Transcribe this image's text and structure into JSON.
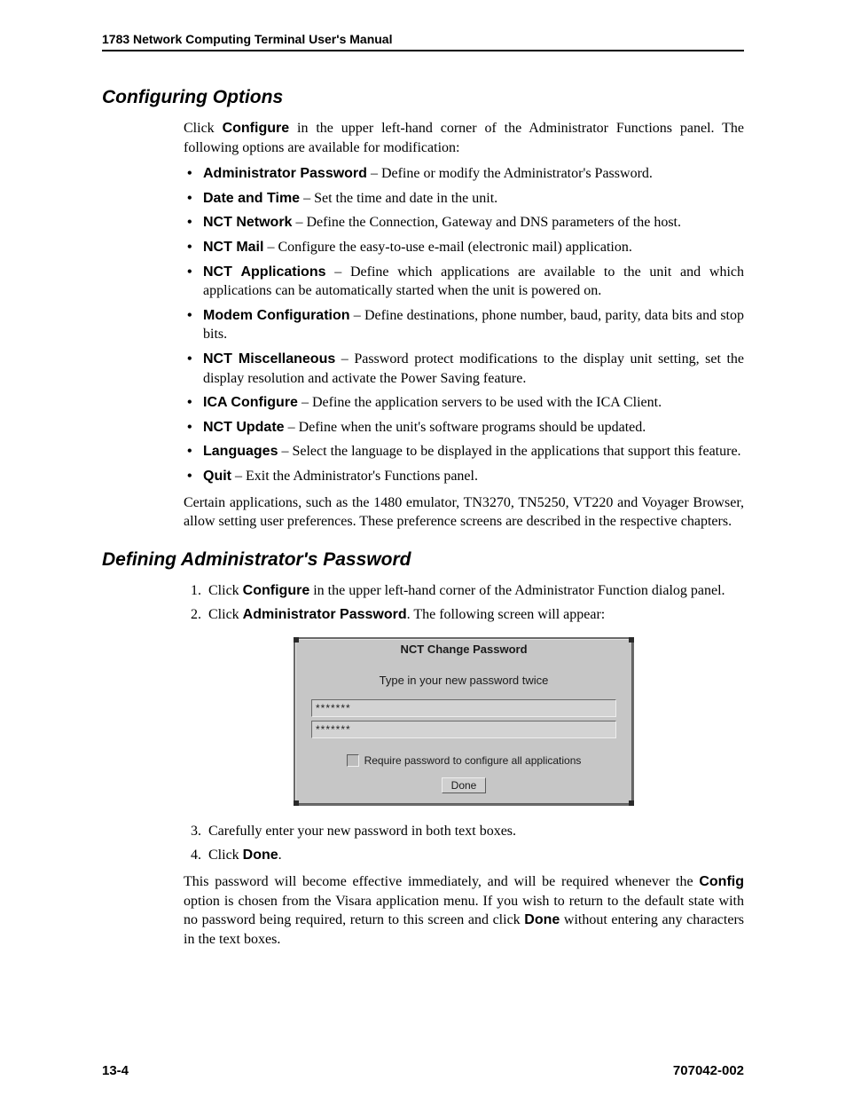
{
  "header": {
    "title": "1783 Network Computing Terminal User's Manual"
  },
  "section1": {
    "heading": "Configuring Options",
    "intro_pre": "Click ",
    "intro_bold": "Configure",
    "intro_post": " in the upper left-hand corner of the Administrator Functions panel. The following options are available for modification:",
    "bullets": [
      {
        "term": "Administrator Password",
        "desc": " – Define or modify the Administrator's Password."
      },
      {
        "term": "Date and Time",
        "desc": " – Set the time and date in the unit."
      },
      {
        "term": "NCT Network",
        "desc": " – Define the Connection, Gateway and DNS parameters of the host."
      },
      {
        "term": "NCT Mail",
        "desc": " – Configure the easy-to-use e-mail (electronic mail) application."
      },
      {
        "term": "NCT Applications",
        "desc": " – Define which applications are available to the unit and which applications can be automatically started when the unit is powered on."
      },
      {
        "term": "Modem Configuration",
        "desc": " – Define destinations, phone number, baud, parity, data bits and stop bits."
      },
      {
        "term": "NCT Miscellaneous",
        "desc": " – Password protect modifications to the display unit setting, set the display resolution and activate the Power Saving feature."
      },
      {
        "term": "ICA Configure",
        "desc": " – Define the application servers to be used with the ICA Client."
      },
      {
        "term": "NCT Update",
        "desc": " – Define when the unit's software programs should be updated."
      },
      {
        "term": "Languages",
        "desc": " – Select the language to be displayed in the applications that support this feature."
      },
      {
        "term": "Quit",
        "desc": " – Exit the Administrator's Functions panel."
      }
    ],
    "outro": "Certain applications, such as the 1480 emulator, TN3270, TN5250, VT220 and Voyager Browser, allow setting user preferences. These preference screens are described in the respective chapters."
  },
  "section2": {
    "heading": "Defining Administrator's Password",
    "step1_pre": "Click ",
    "step1_bold": "Configure",
    "step1_post": " in the upper left-hand corner of the Administrator Function dialog panel.",
    "step2_pre": "Click ",
    "step2_bold": "Administrator Password",
    "step2_post": ". The following screen will appear:",
    "step3": "Carefully enter your new password in both text boxes.",
    "step4_pre": "Click ",
    "step4_bold": "Done",
    "step4_post": ".",
    "closing_a": "This password will become effective immediately, and will be required whenever the ",
    "closing_bold1": "Config",
    "closing_b": " option is chosen from the Visara application menu. If you wish to return to the default state with no password being required, return to this screen and click ",
    "closing_bold2": "Done",
    "closing_c": " without entering any characters in the text boxes."
  },
  "dialog": {
    "title": "NCT Change Password",
    "instruction": "Type in your new password twice",
    "mask1": "*******",
    "mask2": "*******",
    "checkbox_label": "Require password to configure all applications",
    "done": "Done"
  },
  "footer": {
    "left": "13-4",
    "right": "707042-002"
  }
}
